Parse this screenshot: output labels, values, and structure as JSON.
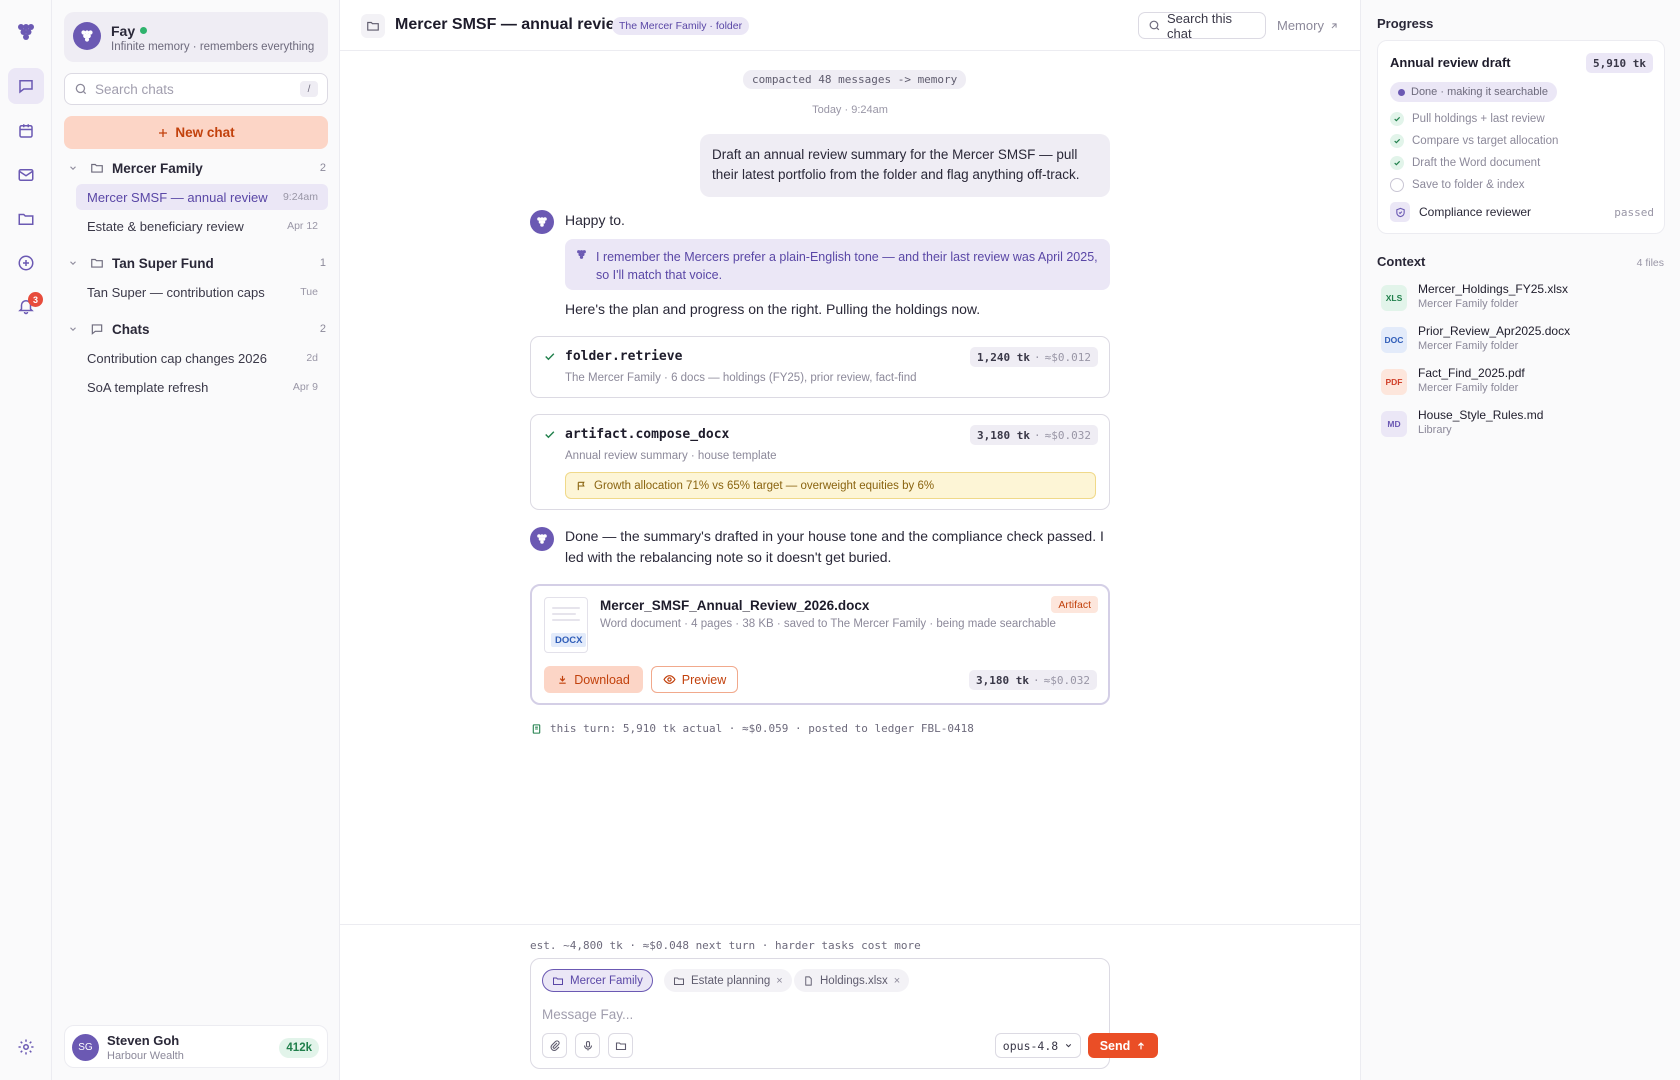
{
  "app": {
    "logo_icon": "grape-logo-icon",
    "brand_color": "#6b59b3",
    "accent_color": "#ea4e26"
  },
  "rail": {
    "notifications_count": "3"
  },
  "sidebar": {
    "agent": {
      "name": "Fay",
      "subtitle": "Infinite memory · remembers everything",
      "status": "online"
    },
    "search": {
      "placeholder": "Search chats",
      "shortcut": "/"
    },
    "new_chat_label": "New chat",
    "groups": [
      {
        "name": "Mercer Family",
        "count": "2",
        "chats": [
          {
            "title": "Mercer SMSF — annual review",
            "time": "9:24am",
            "active": true
          },
          {
            "title": "Estate & beneficiary review",
            "time": "Apr 12"
          }
        ]
      },
      {
        "name": "Tan Super Fund",
        "count": "1",
        "chats": [
          {
            "title": "Tan Super — contribution caps",
            "time": "Tue"
          }
        ]
      },
      {
        "name": "Chats",
        "count": "2",
        "chats": [
          {
            "title": "Contribution cap changes 2026",
            "time": "2d"
          },
          {
            "title": "SoA template refresh",
            "time": "Apr 9"
          }
        ]
      }
    ],
    "user": {
      "initials": "SG",
      "name": "Steven Goh",
      "org": "Harbour Wealth",
      "tokens": "412k"
    }
  },
  "header": {
    "title": "Mercer SMSF — annual review",
    "tag": "The Mercer Family · folder",
    "search_label": "Search this chat",
    "memory_label": "Memory"
  },
  "conversation": {
    "compacted_note": "compacted 48 messages -> memory",
    "day_stamp": "Today · 9:24am",
    "user_message": "Draft an annual review summary for the Mercer SMSF — pull their latest portfolio from the folder and flag anything off-track.",
    "reply_1": "Happy to.",
    "memory_note": "I remember the Mercers prefer a plain-English tone — and their last review was April 2025, so I'll match that voice.",
    "reply_2": "Here's the plan and progress on the right. Pulling the holdings now.",
    "tools": [
      {
        "name": "folder.retrieve",
        "subtitle": "The Mercer Family · 6 docs — holdings (FY25), prior review, fact-find",
        "tokens": "1,240 tk",
        "cost": "≈$0.012"
      },
      {
        "name": "artifact.compose_docx",
        "subtitle": "Annual review summary · house template",
        "tokens": "3,180 tk",
        "cost": "≈$0.032",
        "warning": "Growth allocation 71% vs 65% target — overweight equities by 6%"
      }
    ],
    "reply_3": "Done — the summary's drafted in your house tone and the compliance check passed. I led with the rebalancing note so it doesn't get buried.",
    "artifact": {
      "filename": "Mercer_SMSF_Annual_Review_2026.docx",
      "meta": "Word document · 4 pages · 38 KB · saved to The Mercer Family · being made searchable",
      "ext": "DOCX",
      "badge": "Artifact",
      "download_label": "Download",
      "preview_label": "Preview",
      "tokens": "3,180 tk",
      "cost": "≈$0.032"
    },
    "turn_summary": "this turn: 5,910 tk actual · ≈$0.059 · posted to ledger FBL-0418"
  },
  "composer": {
    "estimate": "est. ~4,800 tk · ≈$0.048 next turn · harder tasks cost more",
    "chips": [
      {
        "label": "Mercer Family",
        "icon": "folder-icon",
        "primary": true
      },
      {
        "label": "Estate planning",
        "icon": "folder-icon",
        "removable": true
      },
      {
        "label": "Holdings.xlsx",
        "icon": "file-icon",
        "removable": true
      }
    ],
    "placeholder": "Message Fay...",
    "model": "opus-4.8",
    "send_label": "Send"
  },
  "progress": {
    "title": "Progress",
    "draft_name": "Annual review draft",
    "draft_tokens": "5,910 tk",
    "status": "Done · making it searchable",
    "steps": [
      {
        "label": "Pull holdings + last review",
        "done": true
      },
      {
        "label": "Compare vs target allocation",
        "done": true
      },
      {
        "label": "Draft the Word document",
        "done": true
      },
      {
        "label": "Save to folder & index",
        "done": false
      }
    ],
    "reviewer": {
      "name": "Compliance reviewer",
      "state": "passed"
    }
  },
  "context": {
    "title": "Context",
    "count": "4 files",
    "files": [
      {
        "badge": "XLS",
        "name": "Mercer_Holdings_FY25.xlsx",
        "location": "Mercer Family folder",
        "color": "#21804c",
        "bg": "#e2f4ea"
      },
      {
        "badge": "DOC",
        "name": "Prior_Review_Apr2025.docx",
        "location": "Mercer Family folder",
        "color": "#2f5db8",
        "bg": "#e3ebfa"
      },
      {
        "badge": "PDF",
        "name": "Fact_Find_2025.pdf",
        "location": "Mercer Family folder",
        "color": "#d0402a",
        "bg": "#fde6dc"
      },
      {
        "badge": "MD",
        "name": "House_Style_Rules.md",
        "location": "Library",
        "color": "#6b59b3",
        "bg": "#ebe7f6"
      }
    ]
  }
}
